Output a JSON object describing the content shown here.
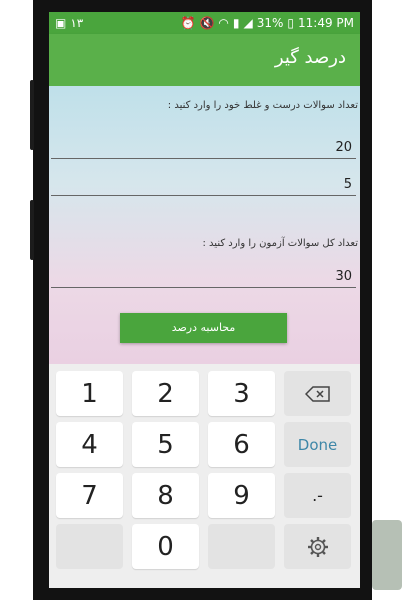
{
  "status_bar": {
    "notif_num": "۱۳",
    "battery": "31%",
    "time": "11:49 PM"
  },
  "app_bar": {
    "title": "درصد گیر"
  },
  "form": {
    "label_correct_wrong": "تعداد سوالات درست و غلط خود را وارد کنید :",
    "correct_value": "20",
    "wrong_value": "5",
    "label_total": "تعداد کل سوالات آزمون را وارد کنید :",
    "total_value": "30",
    "calc_button": "محاسبه درصد"
  },
  "keyboard": {
    "row1": [
      "1",
      "2",
      "3"
    ],
    "row2": [
      "4",
      "5",
      "6"
    ],
    "done": "Done",
    "row3": [
      "7",
      "8",
      "9"
    ],
    "dot": ".-",
    "zero": "0"
  }
}
